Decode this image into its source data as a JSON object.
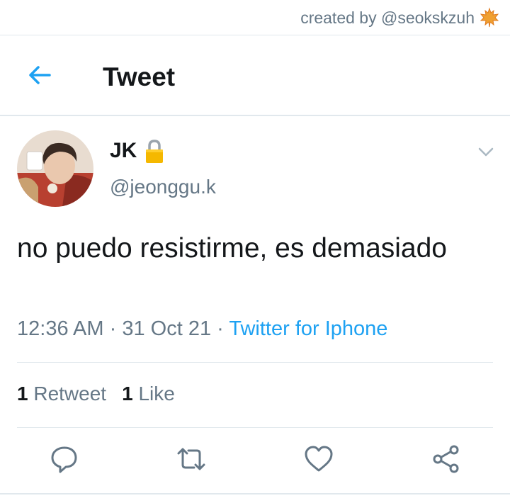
{
  "credit": {
    "text": "created by @seokskzuh",
    "icon": "maple-leaf-icon"
  },
  "header": {
    "title": "Tweet",
    "back_icon": "back-arrow-icon"
  },
  "tweet": {
    "display_name": "JK",
    "lock_icon": "lock-icon",
    "handle": "@jeonggu.k",
    "text": "no puedo resistirme, es demasiado",
    "time": "12:36 AM",
    "separator": "·",
    "date": "31 Oct 21",
    "source": "Twitter for Iphone",
    "retweets_count": "1",
    "retweets_label": "Retweet",
    "likes_count": "1",
    "likes_label": "Like"
  },
  "actions": [
    "reply-icon",
    "retweet-icon",
    "like-icon",
    "share-icon"
  ],
  "colors": {
    "accent": "#1da1f2",
    "secondary_text": "#657786",
    "divider": "#e1e8ed",
    "lock": "#f5b800"
  }
}
